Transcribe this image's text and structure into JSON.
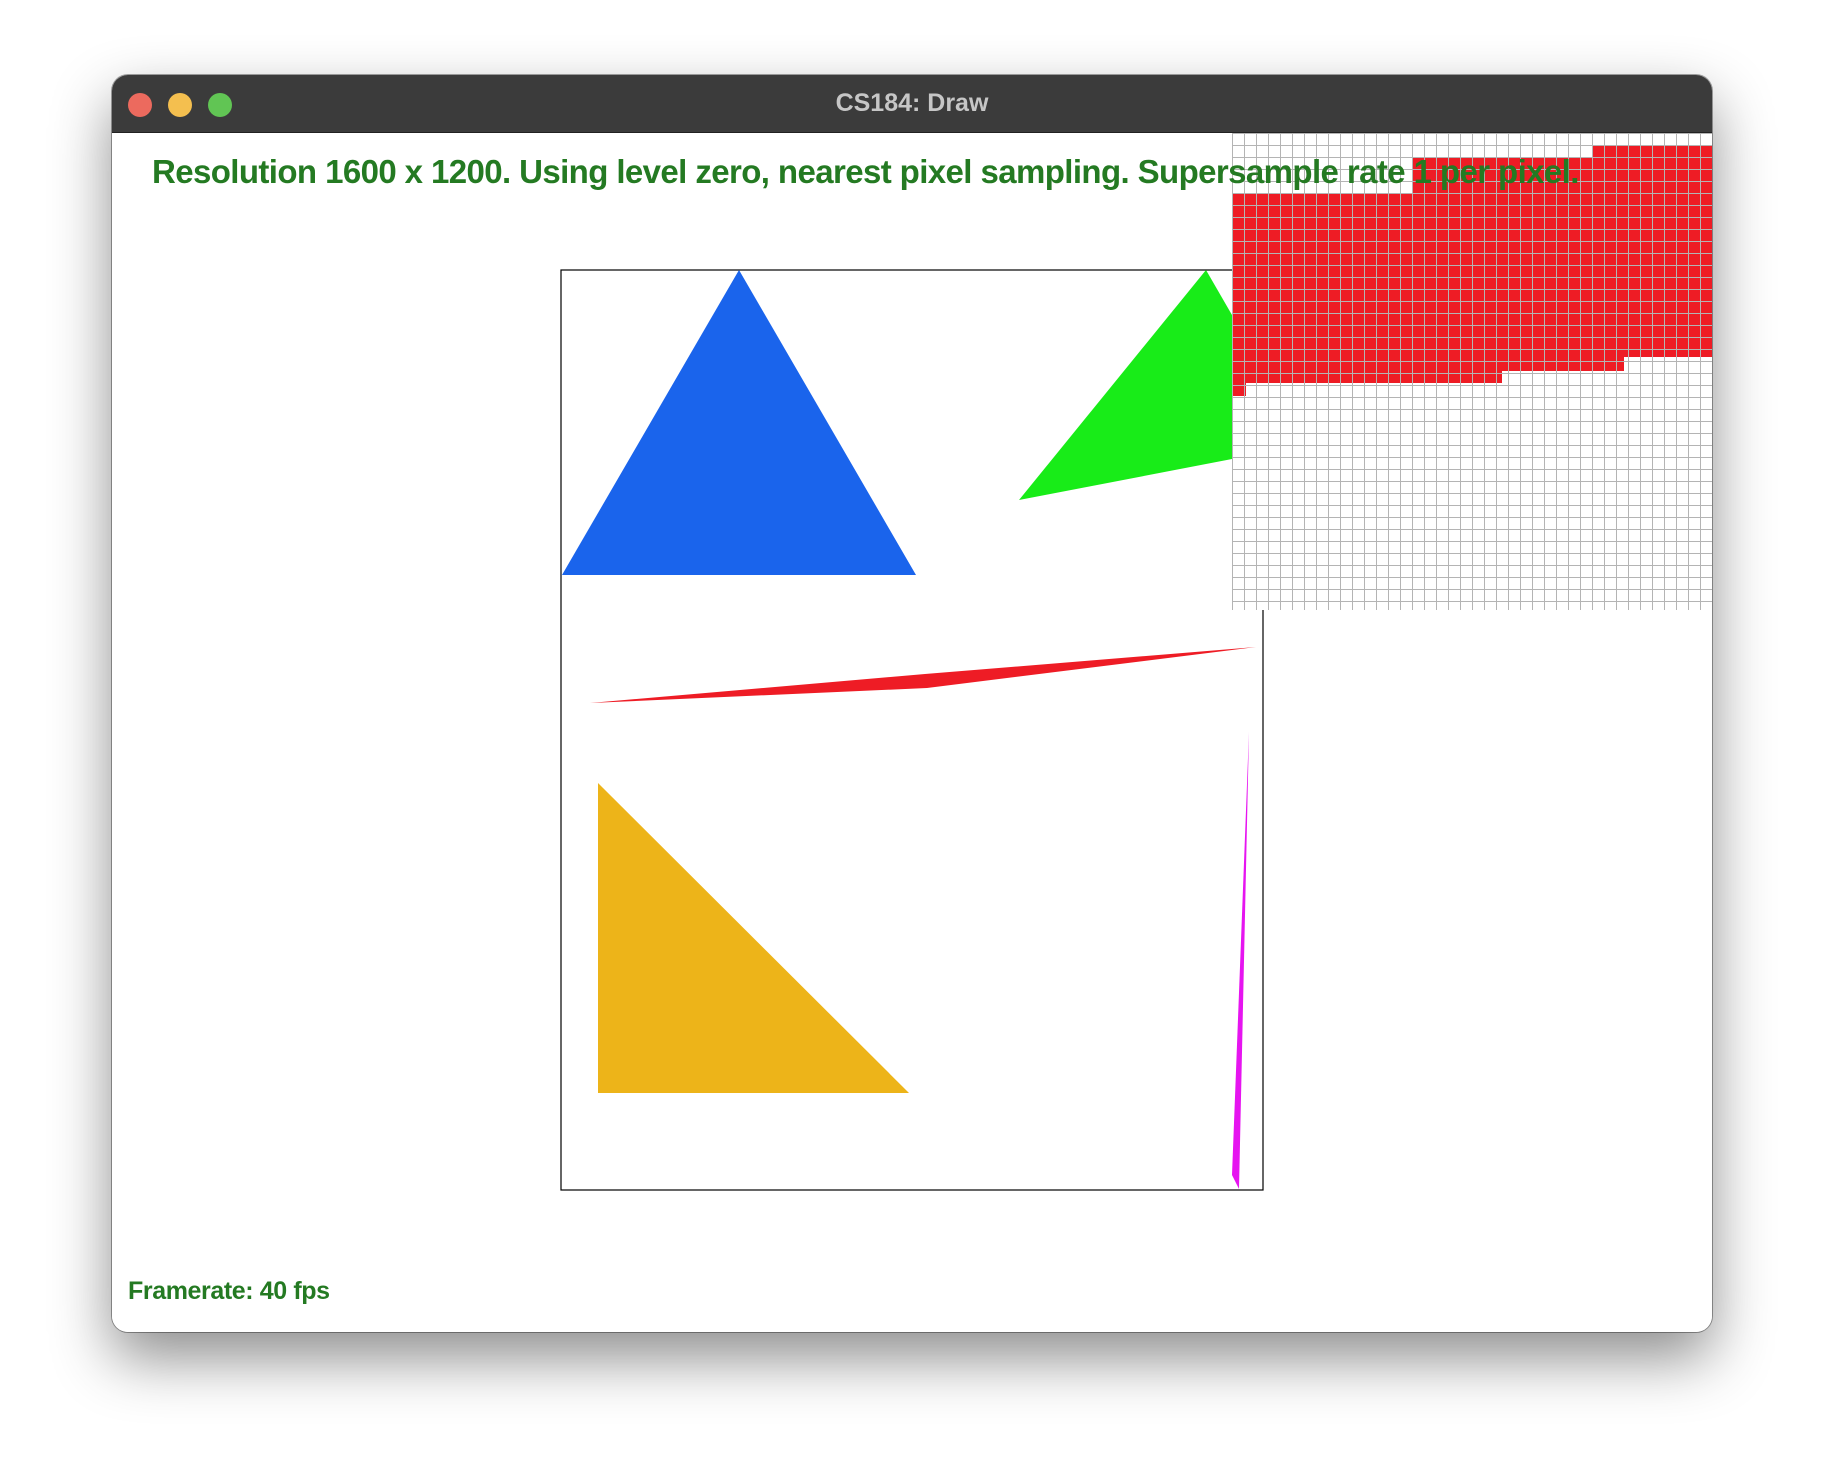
{
  "window": {
    "title": "CS184: Draw",
    "controls": [
      "close",
      "minimize",
      "maximize"
    ]
  },
  "status": {
    "info": "Resolution 1600 x 1200. Using level zero, nearest pixel sampling. Supersample rate 1 per pixel.",
    "framerate": "Framerate: 40 fps"
  },
  "colors": {
    "text": "#247a22",
    "blue_triangle": "#1a64ec",
    "green_triangle": "#18ec18",
    "red_sliver": "#ee1c25",
    "yellow_triangle": "#edb419",
    "magenta_sliver": "#e614f0",
    "zoom_grid_line": "#b4b4b4"
  }
}
